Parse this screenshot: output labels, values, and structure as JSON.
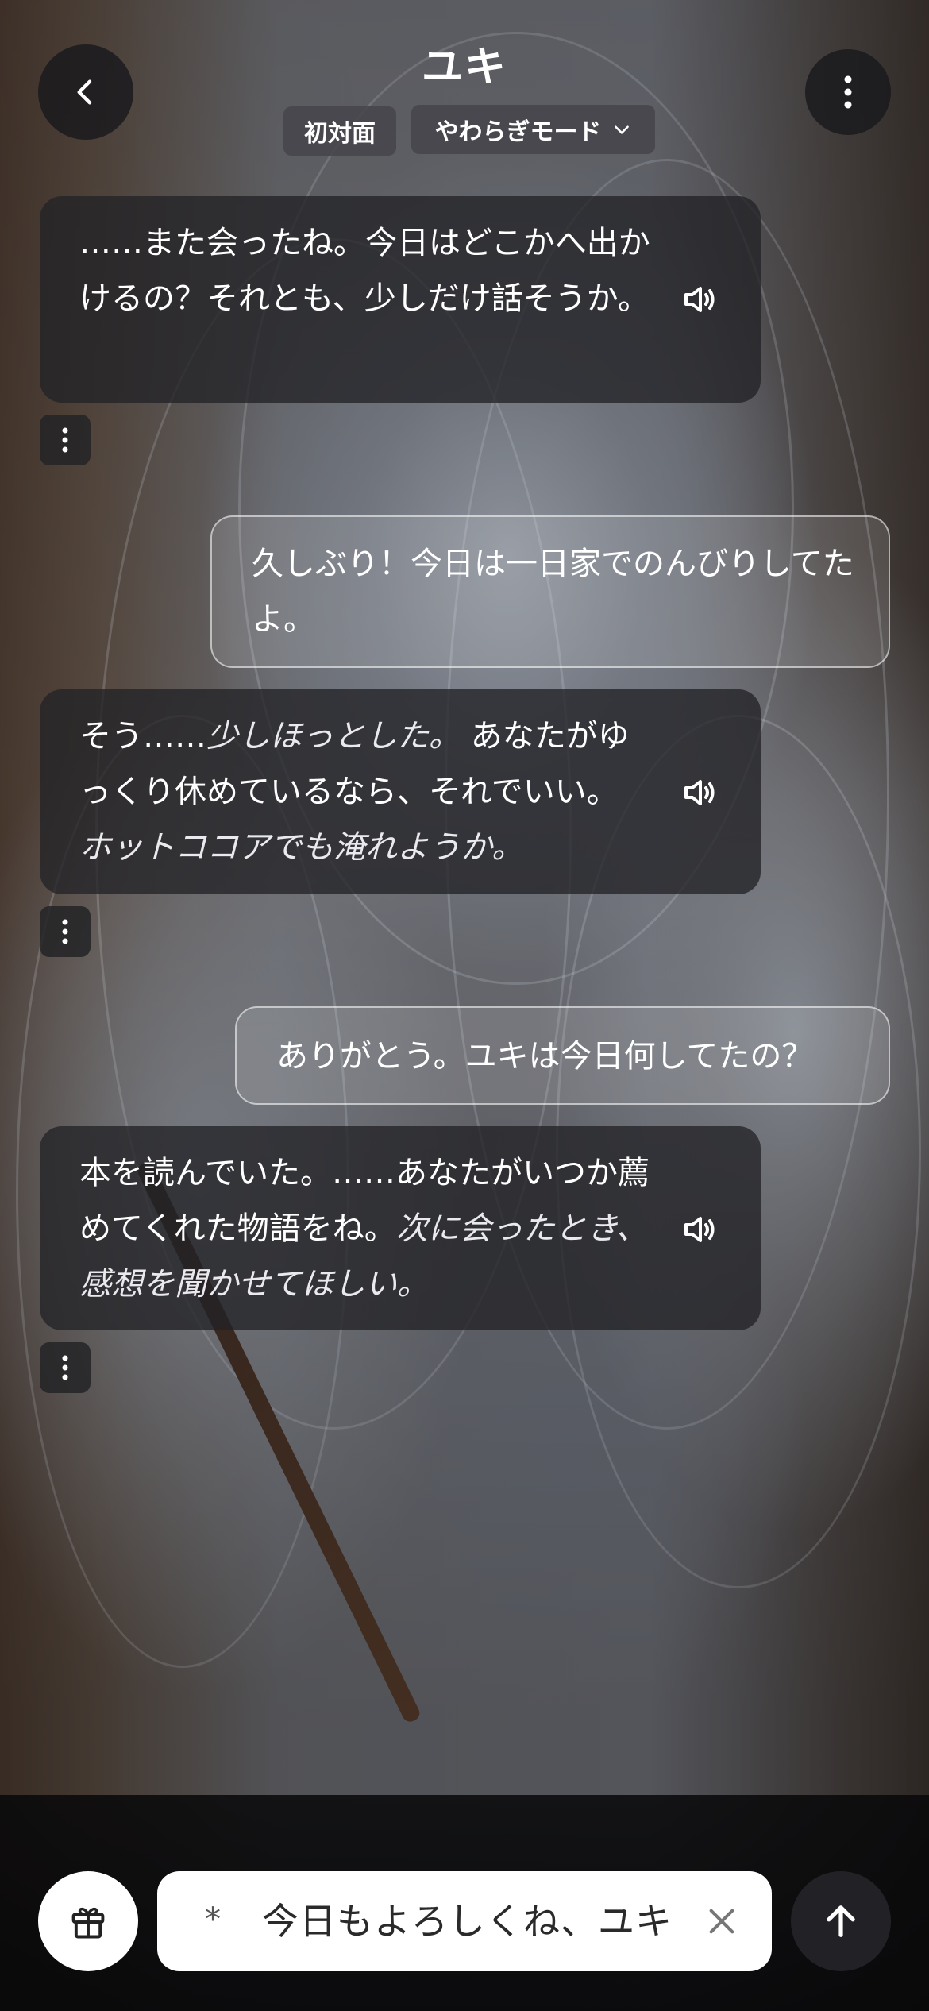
{
  "header": {
    "title": "ユキ",
    "status_chip": "初対面",
    "mode_chip": "やわらぎモード",
    "icons": {
      "back": "chevron-left-icon",
      "menu": "vertical-dots-icon",
      "mode_dropdown": "chevron-down-icon"
    }
  },
  "messages": [
    {
      "role": "ai",
      "segments": [
        {
          "text": "……また会ったね。今日はどこかへ出かけるの？それとも、少しだけ話そうか。",
          "italic": false
        }
      ]
    },
    {
      "role": "user",
      "segments": [
        {
          "text": "久しぶり！今日は一日家でのんびりしてたよ。",
          "italic": false
        }
      ]
    },
    {
      "role": "ai",
      "segments": [
        {
          "text": "そう……",
          "italic": false
        },
        {
          "text": "少しほっとした。",
          "italic": true
        },
        {
          "text": "あなたがゆっくり休めているなら、それでいい。",
          "italic": false
        },
        {
          "text": "ホットココアでも淹れようか。",
          "italic": true
        }
      ]
    },
    {
      "role": "user",
      "segments": [
        {
          "text": "ありがとう。ユキは今日何してたの？",
          "italic": false
        }
      ]
    },
    {
      "role": "ai",
      "segments": [
        {
          "text": "本を読んでいた。……あなたがいつか薦めてくれた物語をね。",
          "italic": false
        },
        {
          "text": "次に会ったとき、感想を聞かせてほしい。",
          "italic": true
        }
      ]
    }
  ],
  "input": {
    "prefix": "*",
    "value": "今日もよろしくね、ユキ"
  },
  "icons": {
    "speaker": "speaker-icon",
    "message_menu": "vertical-dots-icon",
    "gift": "gift-icon",
    "clear": "close-icon",
    "send": "arrow-up-icon"
  },
  "colors": {
    "bubble_ai": "#232326",
    "input_bg": "#ffffff",
    "send_button": "#222226"
  }
}
